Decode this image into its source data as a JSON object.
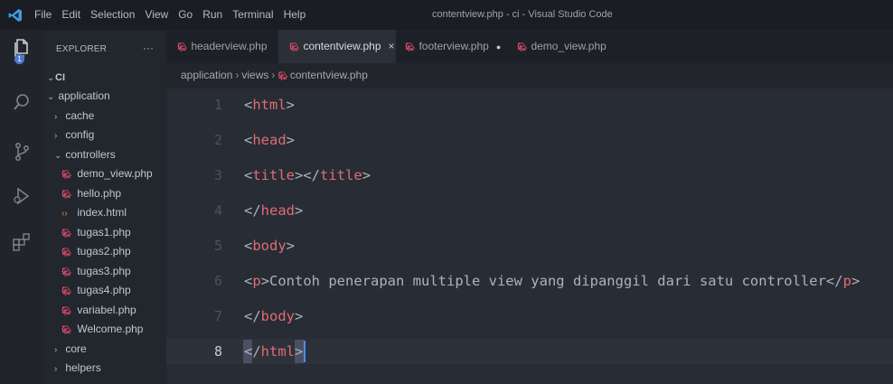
{
  "menu": [
    "File",
    "Edit",
    "Selection",
    "View",
    "Go",
    "Run",
    "Terminal",
    "Help"
  ],
  "window_title": "contentview.php - ci - Visual Studio Code",
  "activity": {
    "badge": "1"
  },
  "explorer": {
    "header": "EXPLORER",
    "more": "···",
    "root": "CI",
    "items": [
      {
        "label": "application",
        "kind": "folder-open",
        "indent": 0
      },
      {
        "label": "cache",
        "kind": "folder",
        "indent": 1
      },
      {
        "label": "config",
        "kind": "folder",
        "indent": 1
      },
      {
        "label": "controllers",
        "kind": "folder-open",
        "indent": 1
      },
      {
        "label": "demo_view.php",
        "kind": "php",
        "indent": 2
      },
      {
        "label": "hello.php",
        "kind": "php",
        "indent": 2
      },
      {
        "label": "index.html",
        "kind": "html",
        "indent": 2
      },
      {
        "label": "tugas1.php",
        "kind": "php",
        "indent": 2
      },
      {
        "label": "tugas2.php",
        "kind": "php",
        "indent": 2
      },
      {
        "label": "tugas3.php",
        "kind": "php",
        "indent": 2
      },
      {
        "label": "tugas4.php",
        "kind": "php",
        "indent": 2
      },
      {
        "label": "variabel.php",
        "kind": "php",
        "indent": 2
      },
      {
        "label": "Welcome.php",
        "kind": "php",
        "indent": 2
      },
      {
        "label": "core",
        "kind": "folder",
        "indent": 1
      },
      {
        "label": "helpers",
        "kind": "folder",
        "indent": 1
      }
    ]
  },
  "tabs": [
    {
      "label": "headerview.php",
      "state": ""
    },
    {
      "label": "contentview.php",
      "state": "×"
    },
    {
      "label": "footerview.php",
      "state": "●"
    },
    {
      "label": "demo_view.php",
      "state": ""
    }
  ],
  "breadcrumb": [
    "application",
    "views",
    "contentview.php"
  ],
  "editor": {
    "lines": [
      {
        "num": "1",
        "tokens": [
          [
            "pun",
            "<"
          ],
          [
            "tg",
            "html"
          ],
          [
            "pun",
            ">"
          ]
        ]
      },
      {
        "num": "2",
        "tokens": [
          [
            "pun",
            "<"
          ],
          [
            "tg",
            "head"
          ],
          [
            "pun",
            ">"
          ]
        ]
      },
      {
        "num": "3",
        "tokens": [
          [
            "pun",
            "<"
          ],
          [
            "tg",
            "title"
          ],
          [
            "pun",
            "></"
          ],
          [
            "tg",
            "title"
          ],
          [
            "pun",
            ">"
          ]
        ]
      },
      {
        "num": "4",
        "tokens": [
          [
            "pun",
            "</"
          ],
          [
            "tg",
            "head"
          ],
          [
            "pun",
            ">"
          ]
        ]
      },
      {
        "num": "5",
        "tokens": [
          [
            "pun",
            "<"
          ],
          [
            "tg",
            "body"
          ],
          [
            "pun",
            ">"
          ]
        ]
      },
      {
        "num": "6",
        "tokens": [
          [
            "pun",
            "<"
          ],
          [
            "tg",
            "p"
          ],
          [
            "pun",
            ">Contoh penerapan multiple view yang dipanggil dari satu controller</"
          ],
          [
            "tg",
            "p"
          ],
          [
            "pun",
            ">"
          ]
        ]
      },
      {
        "num": "7",
        "tokens": [
          [
            "pun",
            "</"
          ],
          [
            "tg",
            "body"
          ],
          [
            "pun",
            ">"
          ]
        ]
      },
      {
        "num": "8",
        "tokens": [
          [
            "pun",
            "</"
          ],
          [
            "tg",
            "html"
          ],
          [
            "pun",
            ">"
          ]
        ]
      }
    ],
    "current_line": "8"
  },
  "colors": {
    "tag": "#e06c75",
    "accent": "#528bff",
    "php_icon": "#d94b6a"
  }
}
